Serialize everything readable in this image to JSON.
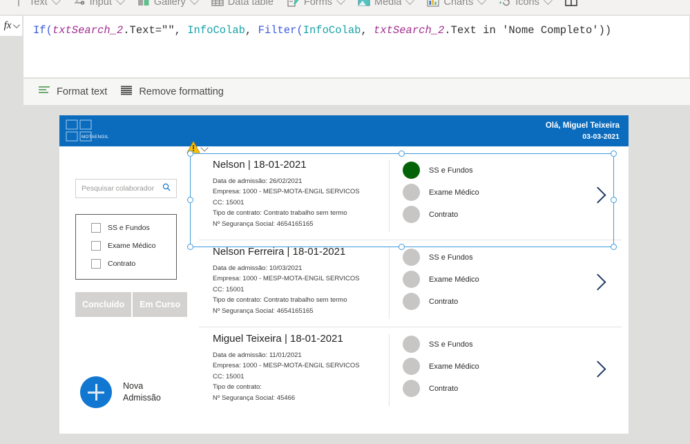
{
  "ribbon": {
    "items": [
      {
        "label": "Text",
        "icon": "text-icon",
        "caret": true
      },
      {
        "label": "Input",
        "icon": "input-icon",
        "caret": true
      },
      {
        "label": "Gallery",
        "icon": "gallery-icon",
        "caret": true
      },
      {
        "label": "Data table",
        "icon": "data-table-icon",
        "caret": false
      },
      {
        "label": "Forms",
        "icon": "forms-icon",
        "caret": true
      },
      {
        "label": "Media",
        "icon": "media-icon",
        "caret": true
      },
      {
        "label": "Charts",
        "icon": "charts-icon",
        "caret": true
      },
      {
        "label": "Icons",
        "icon": "icons-icon",
        "caret": true
      }
    ]
  },
  "formula_bar": {
    "fx_label": "fx",
    "tokens": [
      {
        "text": "If(",
        "kind": "fn"
      },
      {
        "text": "txtSearch_2",
        "kind": "var"
      },
      {
        "text": ".Text=\"\", ",
        "kind": "plain"
      },
      {
        "text": "InfoColab",
        "kind": "tbl"
      },
      {
        "text": ", ",
        "kind": "plain"
      },
      {
        "text": "Filter(",
        "kind": "fn"
      },
      {
        "text": "InfoColab",
        "kind": "tbl"
      },
      {
        "text": ", ",
        "kind": "plain"
      },
      {
        "text": "txtSearch_2",
        "kind": "var"
      },
      {
        "text": ".Text in 'Nome Completo'))",
        "kind": "plain"
      }
    ],
    "full_text": "If(txtSearch_2.Text=\"\", InfoColab, Filter(InfoColab, txtSearch_2.Text in 'Nome Completo'))"
  },
  "format_toolbar": {
    "format_text_label": "Format text",
    "remove_formatting_label": "Remove formatting"
  },
  "app": {
    "header": {
      "logo_text": "MOTAENGIL",
      "greeting": "Olá, Miguel Teixeira",
      "date": "03-03-2021",
      "bg_color": "#0b6bbd"
    },
    "sidebar": {
      "search_placeholder": "Pesquisar colaborador",
      "search_value": "",
      "checkboxes": [
        {
          "label": "SS e Fundos",
          "checked": false
        },
        {
          "label": "Exame Médico",
          "checked": false
        },
        {
          "label": "Contrato",
          "checked": false
        }
      ],
      "segments": [
        {
          "label": "Concluído"
        },
        {
          "label": "Em Curso"
        }
      ],
      "new_admission": {
        "line1": "Nova",
        "line2": "Admissão"
      }
    },
    "gallery": {
      "status_done_color": "#046307",
      "status_pending_color": "#c8c6c4",
      "items": [
        {
          "name": "Nelson | 18-01-2021",
          "details": [
            "Data de admissão: 26/02/2021",
            "Empresa: 1000 - MESP-MOTA-ENGIL SERVICOS",
            "CC: 15001",
            "Tipo de contrato: Contrato trabalho sem termo",
            "Nº Segurança Social: 4654165165"
          ],
          "statuses": [
            {
              "label": "SS e Fundos",
              "state": "done"
            },
            {
              "label": "Exame Médico",
              "state": "pending"
            },
            {
              "label": "Contrato",
              "state": "pending"
            }
          ],
          "selected": true
        },
        {
          "name": "Nelson Ferreira  | 18-01-2021",
          "details": [
            "Data de admissão: 10/03/2021",
            "Empresa: 1000 - MESP-MOTA-ENGIL SERVICOS",
            "CC: 15001",
            "Tipo de contrato: Contrato trabalho sem termo",
            "Nº Segurança Social: 4654165165"
          ],
          "statuses": [
            {
              "label": "SS e Fundos",
              "state": "pending"
            },
            {
              "label": "Exame Médico",
              "state": "pending"
            },
            {
              "label": "Contrato",
              "state": "pending"
            }
          ],
          "selected": false
        },
        {
          "name": "Miguel Teixeira | 18-01-2021",
          "details": [
            "Data de admissão: 11/01/2021",
            "Empresa: 1000 - MESP-MOTA-ENGIL SERVICOS",
            "CC: 15001",
            "Tipo de contrato:",
            "Nº Segurança Social: 45466"
          ],
          "statuses": [
            {
              "label": "SS e Fundos",
              "state": "pending"
            },
            {
              "label": "Exame Médico",
              "state": "pending"
            },
            {
              "label": "Contrato",
              "state": "pending"
            }
          ],
          "selected": false
        }
      ]
    }
  },
  "selection": {
    "accent_color": "#3e9bdd",
    "warning_icon": "warning-triangle-icon"
  }
}
